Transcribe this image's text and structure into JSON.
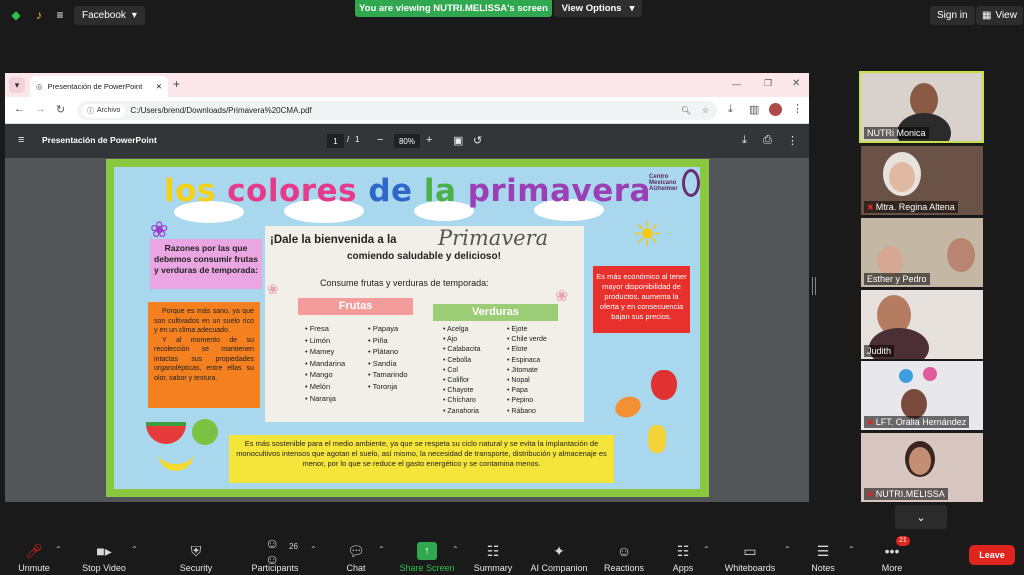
{
  "top_bar": {
    "facebook_label": "Facebook",
    "viewing_banner": "You are viewing NUTRI.MELISSA's screen",
    "view_options": "View Options",
    "sign_in": "Sign in",
    "view_label": "View"
  },
  "browser": {
    "tab_title": "Presentación de PowerPoint",
    "archivo_chip": "Archivo",
    "url": "C:/Users/brend/Downloads/Primavera%20CMA.pdf"
  },
  "pdf_viewer": {
    "title": "Presentación de PowerPoint",
    "page_current": "1",
    "page_separator": "/",
    "page_total": "1",
    "zoom": "80%"
  },
  "slide": {
    "title_word1": "los",
    "title_word2": "colores",
    "title_word3": "de",
    "title_word4": "la",
    "title_word5": "primavera",
    "logo_line1": "Centro",
    "logo_line2": "Mexicano",
    "logo_line3": "Alzheimer",
    "razones": "Razones por las que debemos consumir frutas y verduras de temporada:",
    "porque_p1": "Porque es más sano, ya que son cultivados en un suelo rico y en un clima adecuado.",
    "porque_p2": "Y al momento de su recolección se mantienen intactas sus propiedades organolépticas, entre ellas su olor, sabor y textura.",
    "poster_heading": "¡Dale la bienvenida a la",
    "poster_script": "Primavera",
    "poster_subheading": "comiendo saludable y delicioso!",
    "poster_consume": "Consume frutas y verduras de temporada:",
    "frutas_title": "Frutas",
    "verduras_title": "Verduras",
    "frutas_col1": [
      "Fresa",
      "Limón",
      "Mamey",
      "Mandarina",
      "Mango",
      "Melón",
      "Naranja"
    ],
    "frutas_col2": [
      "Papaya",
      "Piña",
      "Plátano",
      "Sandía",
      "Tamarindo",
      "Toronja"
    ],
    "verduras_col1": [
      "Acelga",
      "Ajo",
      "Calabacita",
      "Cebolla",
      "Col",
      "Coliflor",
      "Chayote",
      "Chícharo",
      "Zanahoria"
    ],
    "verduras_col2": [
      "Ejote",
      "Chile verde",
      "Elote",
      "Espinaca",
      "Jitomate",
      "Nopal",
      "Papa",
      "Pepino",
      "Rábano"
    ],
    "economico": "Es más económico al tener mayor disponibilidad de productos, aumenta la oferta y en consecuencia bajan sus precios.",
    "sostenible": "Es más sostenible para el medio ambiente, ya que se respeta su ciclo natural y se evita la implantación de monocultivos intensos que agotan el suelo, así mismo, la necesidad de transporte, distribución y almacenaje es menor, por lo que se reduce el gasto energético y se contamina menos."
  },
  "participants": [
    {
      "name": "NUTRi Monica",
      "muted": false
    },
    {
      "name": "Mtra. Regina Altena",
      "muted": true
    },
    {
      "name": "Esther y Pedro",
      "muted": false
    },
    {
      "name": "Judith",
      "muted": false
    },
    {
      "name": "LFT. Oralia Hernández",
      "muted": true
    },
    {
      "name": "NUTRI.MELISSA",
      "muted": true
    }
  ],
  "toolbar": {
    "unmute": "Unmute",
    "stop_video": "Stop Video",
    "security": "Security",
    "participants": "Participants",
    "participants_count": "26",
    "chat": "Chat",
    "share_screen": "Share Screen",
    "summary": "Summary",
    "ai_companion": "AI Companion",
    "reactions": "Reactions",
    "apps": "Apps",
    "whiteboards": "Whiteboards",
    "notes": "Notes",
    "more": "More",
    "more_badge": "21",
    "leave": "Leave"
  },
  "colors": {
    "share_green": "#2fa84f",
    "leave_red": "#e0251f",
    "active_speaker": "#c8e04a"
  }
}
